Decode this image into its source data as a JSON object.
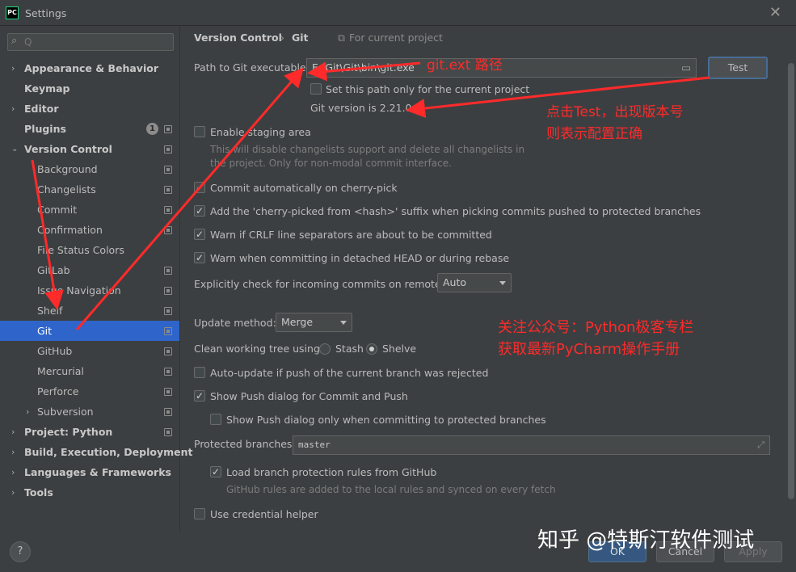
{
  "window": {
    "title": "Settings",
    "app_logo": "PC"
  },
  "search": {
    "placeholder": "Q"
  },
  "sidebar": {
    "items": [
      {
        "label": "Appearance & Behavior"
      },
      {
        "label": "Keymap"
      },
      {
        "label": "Editor"
      },
      {
        "label": "Plugins",
        "badge": "1"
      },
      {
        "label": "Version Control"
      },
      {
        "label": "Background"
      },
      {
        "label": "Changelists"
      },
      {
        "label": "Commit"
      },
      {
        "label": "Confirmation"
      },
      {
        "label": "File Status Colors"
      },
      {
        "label": "GitLab"
      },
      {
        "label": "Issue Navigation"
      },
      {
        "label": "Shelf"
      },
      {
        "label": "Git"
      },
      {
        "label": "GitHub"
      },
      {
        "label": "Mercurial"
      },
      {
        "label": "Perforce"
      },
      {
        "label": "Subversion"
      },
      {
        "label": "Project: Python"
      },
      {
        "label": "Build, Execution, Deployment"
      },
      {
        "label": "Languages & Frameworks"
      },
      {
        "label": "Tools"
      }
    ]
  },
  "breadcrumb": {
    "parent": "Version Control",
    "sep": "›",
    "current": "Git",
    "scope": "For current project"
  },
  "git": {
    "path_label": "Path to Git executable:",
    "path_value": "E:\\Git\\Git\\bin\\git.exe",
    "test_button": "Test",
    "current_project_only": "Set this path only for the current project",
    "version": "Git version is 2.21.0",
    "staging_label": "Enable staging area",
    "staging_desc1": "This will disable changelists support and delete all changelists in",
    "staging_desc2": "the project. Only for non-modal commit interface.",
    "cherry_pick": "Commit automatically on cherry-pick",
    "cherry_suffix": "Add the 'cherry-picked from <hash>' suffix when picking commits pushed to protected branches",
    "crlf": "Warn if CRLF line separators are about to be committed",
    "detached": "Warn when committing in detached HEAD or during rebase",
    "incoming_label": "Explicitly check for incoming commits on remotes:",
    "incoming_value": "Auto",
    "update_label": "Update method:",
    "update_value": "Merge",
    "clean_label": "Clean working tree using:",
    "clean_stash": "Stash",
    "clean_shelve": "Shelve",
    "auto_update": "Auto-update if push of the current branch was rejected",
    "show_push": "Show Push dialog for Commit and Push",
    "show_push_protected": "Show Push dialog only when committing to protected branches",
    "protected_label": "Protected branches:",
    "protected_value": "master",
    "load_rules": "Load branch protection rules from GitHub",
    "load_rules_desc": "GitHub rules are added to the local rules and synced on every fetch",
    "credential": "Use credential helper"
  },
  "checks": {
    "current_project_only": false,
    "staging": false,
    "cherry_pick": true,
    "cherry_suffix": true,
    "crlf": true,
    "detached": true,
    "auto_update": false,
    "show_push": true,
    "show_push_protected": false,
    "load_rules": true,
    "credential": false
  },
  "annotations": {
    "path_note": "git.ext 路径",
    "test_note1": "点击Test，出现版本号",
    "test_note2": "则表示配置正确",
    "follow_note1": "关注公众号：Python极客专栏",
    "follow_note2": "获取最新PyCharm操作手册",
    "watermark": "知乎 @特斯汀软件测试"
  },
  "footer": {
    "help": "?",
    "ok": "OK",
    "cancel": "Cancel",
    "apply": "Apply"
  },
  "colors": {
    "selection": "#2f65ca",
    "annotation": "#ff2a2a",
    "background": "#3c3f41"
  }
}
